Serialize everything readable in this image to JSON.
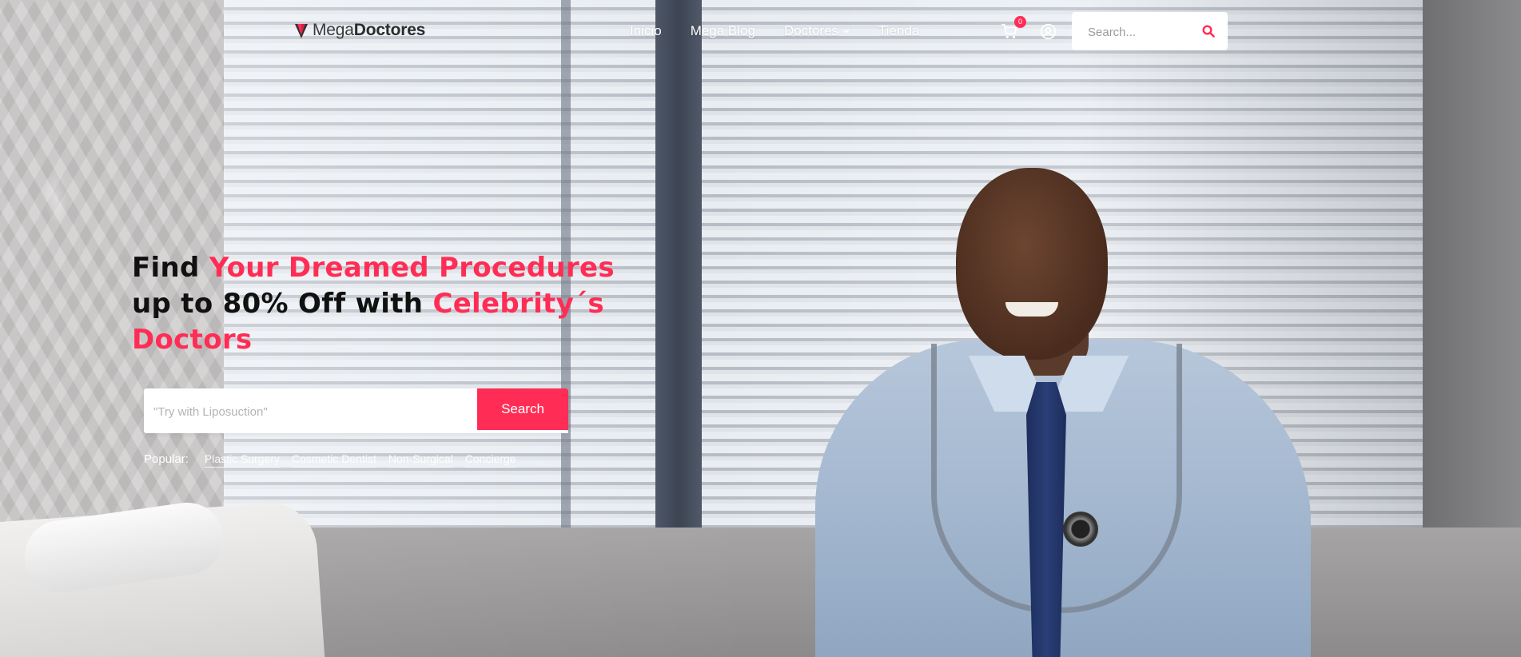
{
  "header": {
    "logo": {
      "light": "Mega",
      "bold": "Doctores"
    },
    "nav": [
      {
        "label": "Inicio"
      },
      {
        "label": "Mega Blog"
      },
      {
        "label": "Doctores",
        "has_dropdown": true
      },
      {
        "label": "Tienda"
      }
    ],
    "cart": {
      "count": "0",
      "icon": "cart-icon"
    },
    "user": {
      "icon": "user-circle-icon"
    },
    "search": {
      "placeholder": "Search...",
      "icon": "search-icon"
    }
  },
  "hero": {
    "title": {
      "part1": "Find ",
      "part2": "Your Dreamed Procedures",
      "part3": "up to 80% Off with ",
      "part4": "Celebrity´s Doctors"
    },
    "search": {
      "placeholder": "\"Try with Liposuction\"",
      "button_label": "Search"
    },
    "popular": {
      "label": "Popular:",
      "links": [
        "Plastic Surgery",
        "Cosmetic Dentist",
        "Non-Surgical",
        "Concierge"
      ]
    }
  },
  "colors": {
    "accent": "#ff2d55",
    "text_dark": "#111111"
  }
}
